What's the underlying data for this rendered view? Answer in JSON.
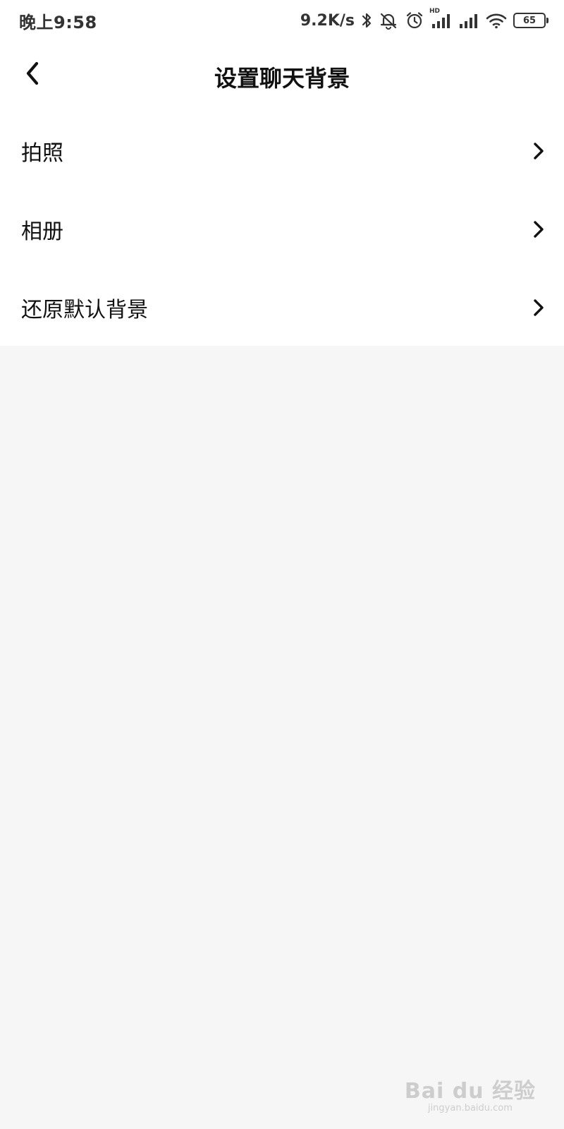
{
  "status_bar": {
    "time": "晚上9:58",
    "net_speed": "9.2K/s",
    "battery": "65",
    "hd_label": "HD",
    "icons": [
      "bluetooth-icon",
      "mute-bell-icon",
      "alarm-icon",
      "signal-hd-icon",
      "signal-icon",
      "wifi-icon",
      "battery-icon"
    ]
  },
  "nav": {
    "title": "设置聊天背景",
    "back_icon": "chevron-left-icon"
  },
  "menu": {
    "items": [
      {
        "label": "拍照"
      },
      {
        "label": "相册"
      },
      {
        "label": "还原默认背景"
      }
    ]
  },
  "watermark": {
    "brand": "Bai du 经验",
    "url": "jingyan.baidu.com"
  },
  "colors": {
    "background": "#f6f6f6",
    "surface": "#ffffff",
    "text": "#111111",
    "status_text": "#333333",
    "watermark": "#c9c9c9"
  }
}
